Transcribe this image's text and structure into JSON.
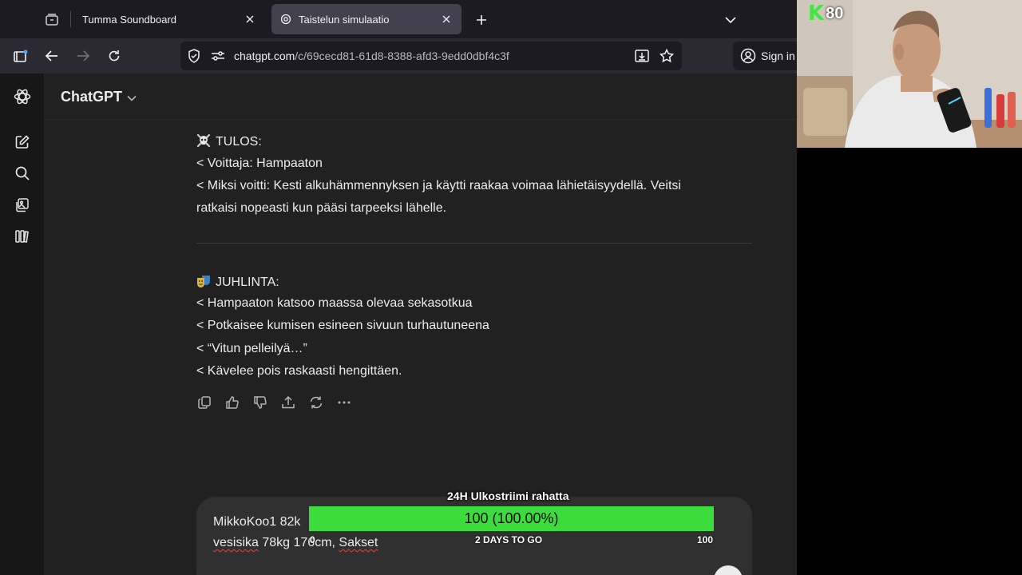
{
  "browser": {
    "tabs": [
      {
        "title": "Tumma Soundboard",
        "active": false
      },
      {
        "title": "Taistelun simulaatio",
        "active": true
      }
    ],
    "url_main": "chatgpt.com",
    "url_rest": "/c/69cecd81-61d8-8388-afd3-9edd0dbf4c3f",
    "sign_in": "Sign in"
  },
  "app": {
    "model_title": "ChatGPT"
  },
  "message": {
    "result_heading": "TULOS:",
    "result_lines": [
      "< Voittaja: Hampaaton",
      "< Miksi voitti: Kesti alkuhämmennyksen ja käytti raakaa voimaa lähietäisyydellä. Veitsi",
      "ratkaisi nopeasti kun pääsi tarpeeksi lähelle."
    ],
    "celebration_heading": "JUHLINTA:",
    "celebration_lines": [
      "< Hampaaton katsoo maassa olevaa sekasotkua",
      "< Potkaisee kumisen esineen sivuun turhautuneena",
      "< “Vitun pelleilyä…”",
      "< Kävelee pois raskaasti hengittäen."
    ]
  },
  "composer": {
    "line1": "MikkoKoo1 82k",
    "line2_a": "vesisika",
    "line2_b": " 78kg 176cm, ",
    "line2_c": "Sakset"
  },
  "overlay": {
    "goal_title": "24H Ulkostriimi rahatta",
    "goal_value_text": "100 (100.00%)",
    "goal_progress": 1.0,
    "days_to_go": "2 DAYS TO GO",
    "min_label": "0",
    "max_label": "100",
    "bar_color": "#3bdc3b"
  },
  "webcam": {
    "badge_letter": "K",
    "badge_number": "80"
  }
}
